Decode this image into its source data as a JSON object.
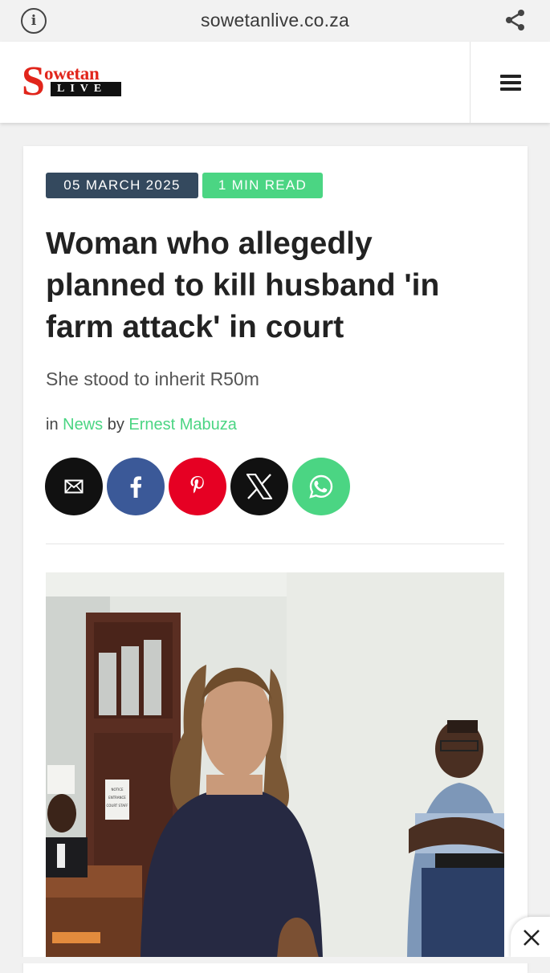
{
  "browser": {
    "url": "sowetanlive.co.za",
    "info_icon": "info-icon",
    "share_icon": "share-icon"
  },
  "site": {
    "logo_text_main": "Sowetan",
    "logo_text_sub": "LIVE",
    "menu_icon": "hamburger-menu-icon",
    "brand_color": "#e1251b"
  },
  "article": {
    "date": "05 MARCH 2025",
    "read_time": "1 MIN READ",
    "headline": "Woman who allegedly planned to kill husband 'in farm attack' in court",
    "subheadline": "She stood to inherit R50m",
    "byline": {
      "in_label": "in",
      "section": "News",
      "by_label": "by",
      "author": "Ernest Mabuza"
    },
    "share": [
      {
        "name": "email",
        "icon": "email-icon",
        "color": "#111111"
      },
      {
        "name": "facebook",
        "icon": "facebook-icon",
        "color": "#3b5998"
      },
      {
        "name": "pinterest",
        "icon": "pinterest-icon",
        "color": "#e60023"
      },
      {
        "name": "x",
        "icon": "x-icon",
        "color": "#111111"
      },
      {
        "name": "whatsapp",
        "icon": "whatsapp-icon",
        "color": "#4bd583"
      }
    ],
    "image_notice": {
      "line1": "NOTICE",
      "line2": "ENTRANCE",
      "line3": "COURT STAFF"
    }
  },
  "colors": {
    "date_tag": "#34495e",
    "accent_green": "#4bd583"
  },
  "ad": {
    "close_icon": "close-icon"
  }
}
